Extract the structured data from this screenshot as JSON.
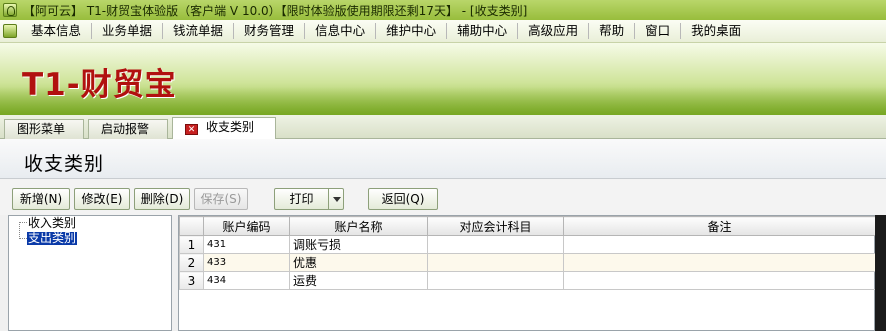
{
  "window": {
    "title": "【阿可云】 T1-财贸宝体验版（客户端 V 10.0）【限时体验版使用期限还剩17天】 - [收支类别]"
  },
  "menu": {
    "items": [
      "基本信息",
      "业务单据",
      "钱流单据",
      "财务管理",
      "信息中心",
      "维护中心",
      "辅助中心",
      "高级应用",
      "帮助",
      "窗口",
      "我的桌面"
    ]
  },
  "banner": {
    "logo_text": "T1-财贸宝"
  },
  "tabs": {
    "items": [
      {
        "label": "图形菜单",
        "active": false
      },
      {
        "label": "启动报警",
        "active": false
      },
      {
        "label": "收支类别",
        "active": true
      }
    ],
    "close_glyph": "✕"
  },
  "page": {
    "title": "收支类别"
  },
  "toolbar": {
    "add": "新增(N)",
    "edit": "修改(E)",
    "delete": "删除(D)",
    "save": "保存(S)",
    "print": "打印",
    "back": "返回(Q)"
  },
  "tree": {
    "nodes": [
      {
        "label": "收入类别",
        "selected": false
      },
      {
        "label": "支出类别",
        "selected": true
      }
    ]
  },
  "grid": {
    "headers": [
      "",
      "账户编码",
      "账户名称",
      "对应会计科目",
      "备注"
    ],
    "rows": [
      {
        "no": "1",
        "code": "431",
        "name": "调账亏损",
        "subject": "",
        "remark": ""
      },
      {
        "no": "2",
        "code": "433",
        "name": "优惠",
        "subject": "",
        "remark": ""
      },
      {
        "no": "3",
        "code": "434",
        "name": "运费",
        "subject": "",
        "remark": ""
      }
    ]
  },
  "colors": {
    "title_bar": "#a9cc4e",
    "logo_red": "#b1110f",
    "selection_blue": "#0a3aa8"
  }
}
